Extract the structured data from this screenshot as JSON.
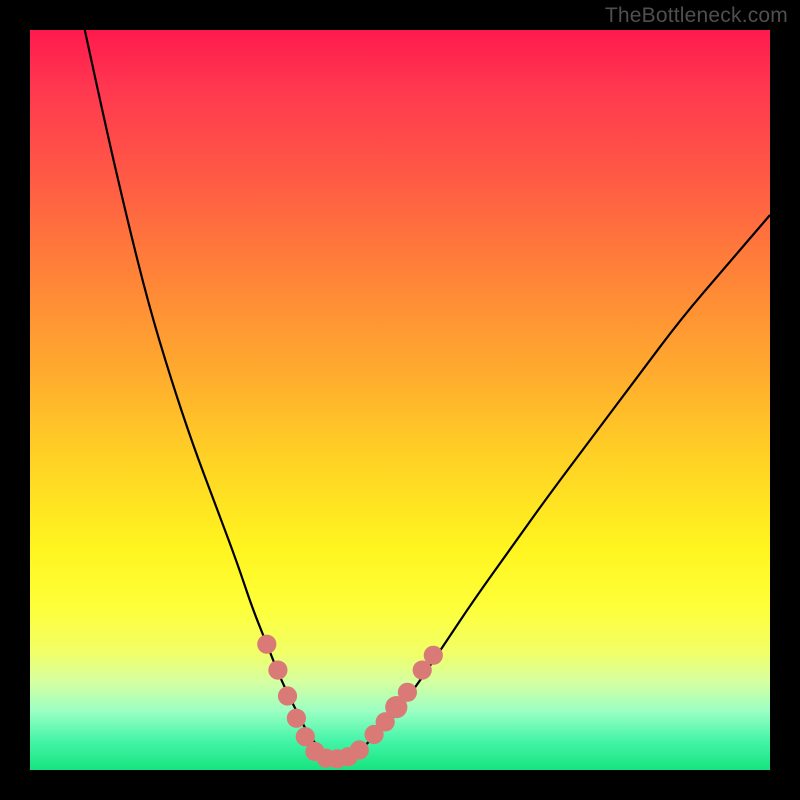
{
  "watermark": "TheBottleneck.com",
  "chart_data": {
    "type": "line",
    "title": "",
    "xlabel": "",
    "ylabel": "",
    "xlim": [
      0,
      100
    ],
    "ylim": [
      0,
      100
    ],
    "gradient_stops": [
      {
        "pos": 0,
        "color": "#ff1a4d"
      },
      {
        "pos": 8,
        "color": "#ff3850"
      },
      {
        "pos": 20,
        "color": "#ff5a45"
      },
      {
        "pos": 33,
        "color": "#ff8338"
      },
      {
        "pos": 46,
        "color": "#ffaa2e"
      },
      {
        "pos": 58,
        "color": "#ffd225"
      },
      {
        "pos": 70,
        "color": "#fff51f"
      },
      {
        "pos": 78,
        "color": "#feff3a"
      },
      {
        "pos": 84,
        "color": "#f2ff66"
      },
      {
        "pos": 88,
        "color": "#d6ffa0"
      },
      {
        "pos": 92,
        "color": "#9cffc4"
      },
      {
        "pos": 96,
        "color": "#45f5a8"
      },
      {
        "pos": 100,
        "color": "#16e47f"
      }
    ],
    "series": [
      {
        "name": "bottleneck-curve",
        "color": "#000000",
        "x": [
          7.4,
          10,
          13,
          16,
          19,
          22,
          25,
          28,
          30,
          32,
          34,
          36,
          37.5,
          39,
          41,
          43,
          45,
          48,
          52,
          56,
          60,
          65,
          70,
          76,
          82,
          88,
          94,
          100
        ],
        "y": [
          100,
          88,
          75,
          63,
          53,
          44,
          36,
          28,
          22,
          17,
          12,
          8,
          5,
          3,
          1.5,
          1.5,
          3,
          6,
          11,
          17,
          23,
          30,
          37,
          45,
          53,
          61,
          68,
          75
        ]
      }
    ],
    "markers": [
      {
        "name": "marker-left-1",
        "x": 32.0,
        "y": 17.0,
        "r": 1.3,
        "color": "#da7a77"
      },
      {
        "name": "marker-left-2",
        "x": 33.5,
        "y": 13.5,
        "r": 1.3,
        "color": "#da7a77"
      },
      {
        "name": "marker-left-3",
        "x": 34.8,
        "y": 10.0,
        "r": 1.3,
        "color": "#da7a77"
      },
      {
        "name": "marker-left-4",
        "x": 36.0,
        "y": 7.0,
        "r": 1.3,
        "color": "#da7a77"
      },
      {
        "name": "marker-left-5",
        "x": 37.2,
        "y": 4.5,
        "r": 1.3,
        "color": "#da7a77"
      },
      {
        "name": "marker-bottom-1",
        "x": 38.5,
        "y": 2.5,
        "r": 1.3,
        "color": "#da7a77"
      },
      {
        "name": "marker-bottom-2",
        "x": 40.0,
        "y": 1.6,
        "r": 1.3,
        "color": "#da7a77"
      },
      {
        "name": "marker-bottom-3",
        "x": 41.5,
        "y": 1.5,
        "r": 1.3,
        "color": "#da7a77"
      },
      {
        "name": "marker-bottom-4",
        "x": 43.0,
        "y": 1.8,
        "r": 1.3,
        "color": "#da7a77"
      },
      {
        "name": "marker-bottom-5",
        "x": 44.5,
        "y": 2.7,
        "r": 1.3,
        "color": "#da7a77"
      },
      {
        "name": "marker-right-1",
        "x": 46.5,
        "y": 4.8,
        "r": 1.3,
        "color": "#da7a77"
      },
      {
        "name": "marker-right-2",
        "x": 48.0,
        "y": 6.5,
        "r": 1.3,
        "color": "#da7a77"
      },
      {
        "name": "marker-right-3",
        "x": 49.5,
        "y": 8.5,
        "r": 1.5,
        "color": "#da7a77"
      },
      {
        "name": "marker-right-4",
        "x": 51.0,
        "y": 10.5,
        "r": 1.3,
        "color": "#da7a77"
      },
      {
        "name": "marker-right-5",
        "x": 53.0,
        "y": 13.5,
        "r": 1.3,
        "color": "#da7a77"
      },
      {
        "name": "marker-right-6",
        "x": 54.5,
        "y": 15.5,
        "r": 1.3,
        "color": "#da7a77"
      }
    ]
  }
}
